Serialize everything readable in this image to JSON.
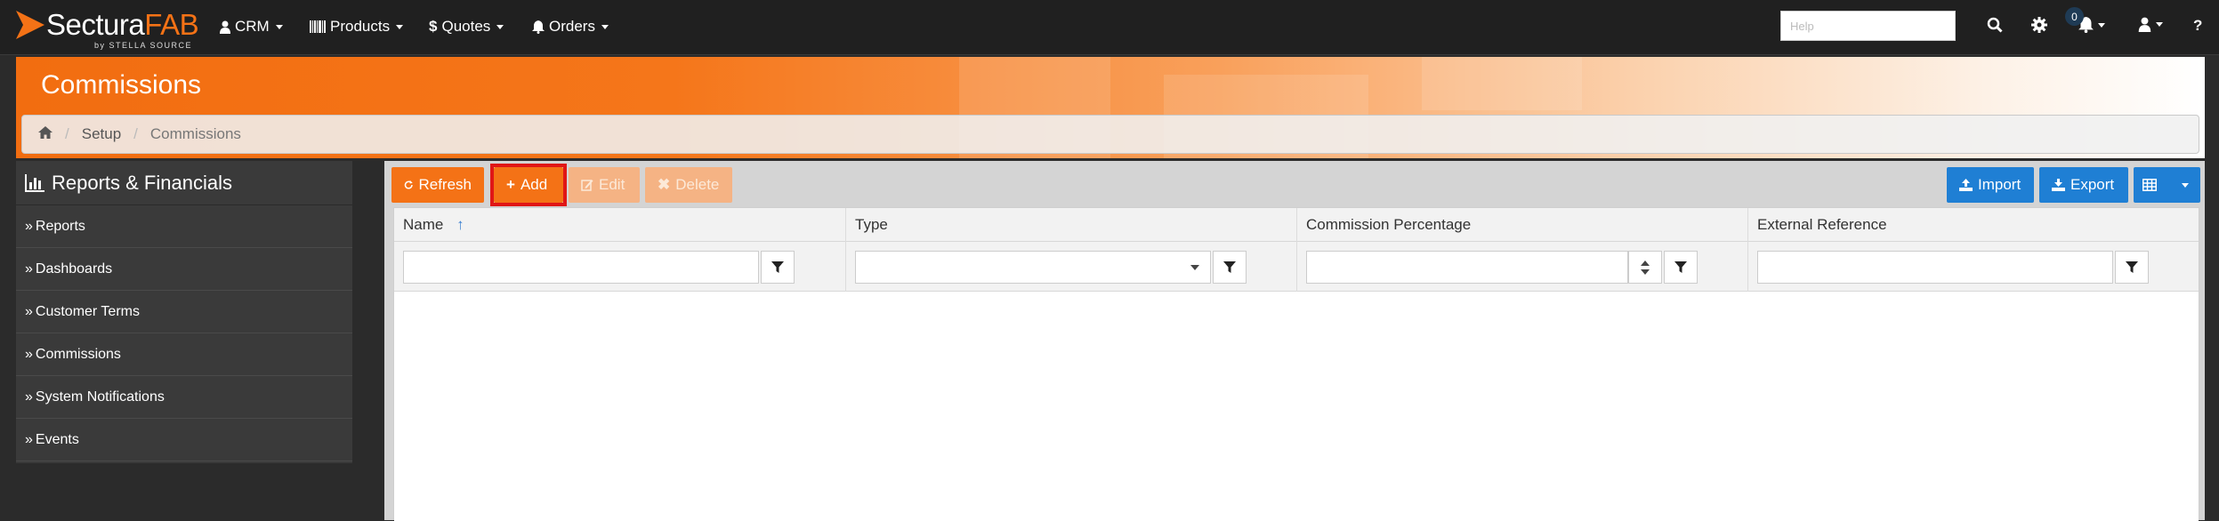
{
  "brand": {
    "name_part1": "Sectura",
    "name_part2": "FAB",
    "tagline": "by STELLA SOURCE"
  },
  "nav": {
    "items": [
      {
        "label": "CRM",
        "icon": "user-icon"
      },
      {
        "label": "Products",
        "icon": "barcode-icon"
      },
      {
        "label": "Quotes",
        "icon": "dollar-icon"
      },
      {
        "label": "Orders",
        "icon": "bell-icon"
      }
    ],
    "help_placeholder": "Help",
    "notification_count": "0",
    "help_label": "?"
  },
  "page": {
    "title": "Commissions"
  },
  "breadcrumb": {
    "items": [
      "Setup",
      "Commissions"
    ]
  },
  "sidebar": {
    "title": "Reports & Financials",
    "items": [
      {
        "label": "Reports"
      },
      {
        "label": "Dashboards"
      },
      {
        "label": "Customer Terms"
      },
      {
        "label": "Commissions"
      },
      {
        "label": "System Notifications"
      },
      {
        "label": "Events"
      }
    ]
  },
  "toolbar": {
    "refresh": "Refresh",
    "add": "Add",
    "edit": "Edit",
    "delete": "Delete",
    "import": "Import",
    "export": "Export"
  },
  "grid": {
    "columns": [
      "Name",
      "Type",
      "Commission Percentage",
      "External Reference"
    ],
    "sort": {
      "column": "Name",
      "direction": "ascending"
    },
    "rows": []
  },
  "colors": {
    "accent_orange": "#f47216",
    "primary_blue": "#1f7fd4",
    "highlight_red": "#e01616",
    "navbar": "#202020"
  }
}
